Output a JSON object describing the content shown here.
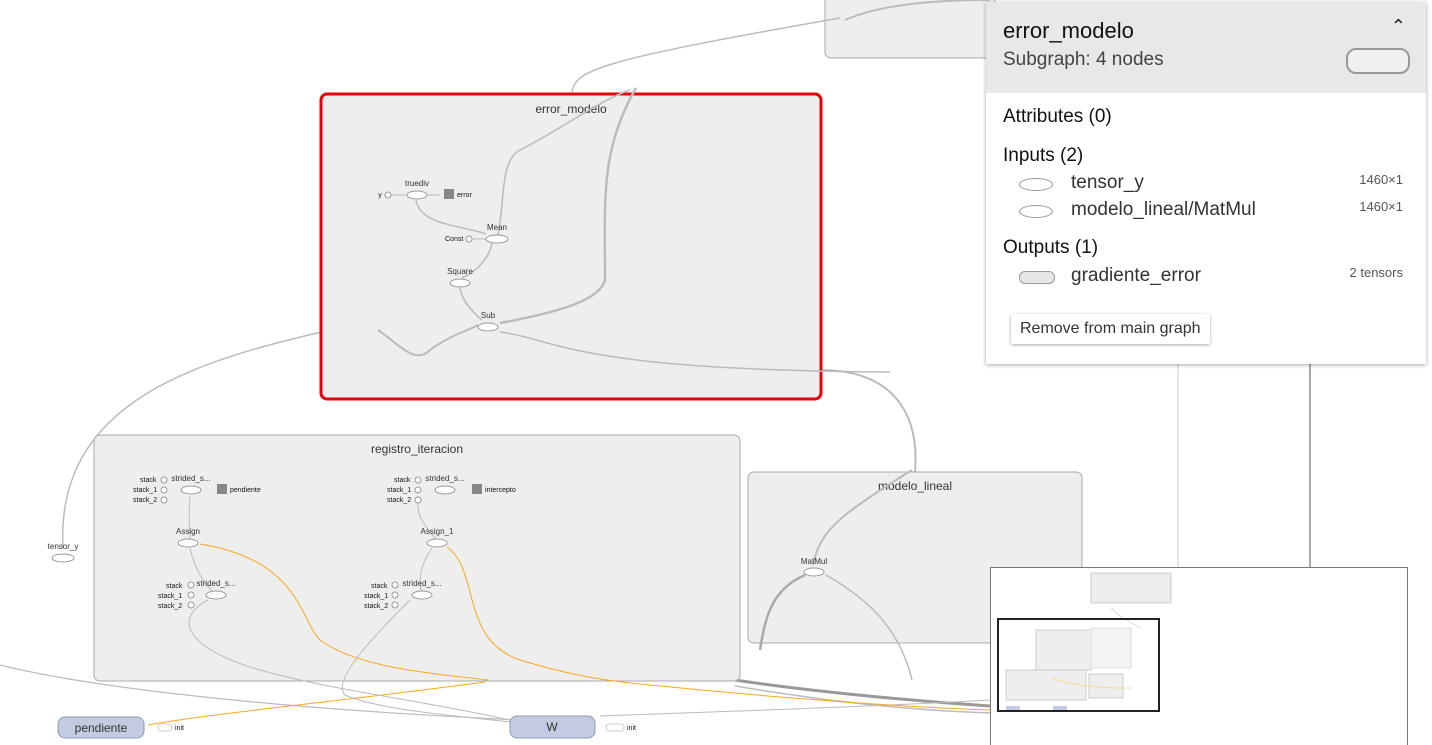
{
  "graph": {
    "groups": {
      "error_modelo": "error_modelo",
      "registro_iteracion": "registro_iteracion",
      "modelo_lineal": "modelo_lineal"
    },
    "nodes": {
      "y": "y",
      "truediv": "truediv",
      "error": "error",
      "mean": "Mean",
      "const": "Const",
      "square": "Square",
      "sub": "Sub",
      "strided_s": "strided_s...",
      "stack": "stack",
      "stack_1": "stack_1",
      "stack_2": "stack_2",
      "pendiente_summary": "pendiente",
      "intercepto_summary": "intercepto",
      "assign": "Assign",
      "assign_1": "Assign_1",
      "matmul": "MatMul",
      "tensor_y": "tensor_y",
      "pendiente": "pendiente",
      "W": "W",
      "init": "init"
    }
  },
  "info_card": {
    "title": "error_modelo",
    "subtitle": "Subgraph: 4 nodes",
    "collapse_icon": "chevron-up",
    "attributes_header": "Attributes (0)",
    "inputs_header": "Inputs (2)",
    "inputs": [
      {
        "name": "tensor_y",
        "size": "1460×1"
      },
      {
        "name": "modelo_lineal/MatMul",
        "size": "1460×1"
      }
    ],
    "outputs_header": "Outputs (1)",
    "outputs": [
      {
        "name": "gradiente_error",
        "size": "2 tensors"
      }
    ],
    "remove_button": "Remove from main graph"
  },
  "colors": {
    "selected_border": "#e8000b",
    "group_fill": "#eeeeee",
    "variable_fill": "#c3cbe0",
    "edge": "#b8b8b8",
    "ref_edge": "#f7a81b"
  }
}
